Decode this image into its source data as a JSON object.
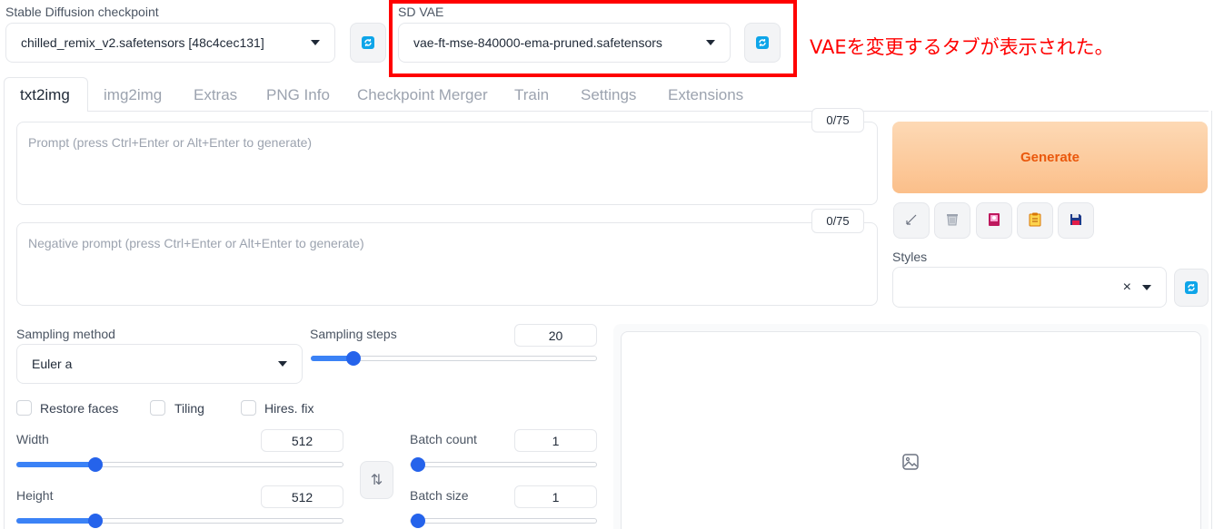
{
  "checkpoint": {
    "label": "Stable Diffusion checkpoint",
    "value": "chilled_remix_v2.safetensors [48c4cec131]"
  },
  "vae": {
    "label": "SD VAE",
    "value": "vae-ft-mse-840000-ema-pruned.safetensors"
  },
  "annotation": "VAEを変更するタブが表示された。",
  "tabs": [
    "txt2img",
    "img2img",
    "Extras",
    "PNG Info",
    "Checkpoint Merger",
    "Train",
    "Settings",
    "Extensions"
  ],
  "prompt": {
    "placeholder": "Prompt (press Ctrl+Enter or Alt+Enter to generate)",
    "counter": "0/75"
  },
  "negative_prompt": {
    "placeholder": "Negative prompt (press Ctrl+Enter or Alt+Enter to generate)",
    "counter": "0/75"
  },
  "generate_label": "Generate",
  "styles": {
    "label": "Styles",
    "clear": "×"
  },
  "sampling": {
    "method_label": "Sampling method",
    "method_value": "Euler a",
    "steps_label": "Sampling steps",
    "steps_value": "20"
  },
  "checkboxes": {
    "restore_faces": "Restore faces",
    "tiling": "Tiling",
    "hires_fix": "Hires. fix"
  },
  "dims": {
    "width_label": "Width",
    "width_value": "512",
    "height_label": "Height",
    "height_value": "512",
    "swap_icon": "⇅"
  },
  "batch": {
    "count_label": "Batch count",
    "count_value": "1",
    "size_label": "Batch size",
    "size_value": "1"
  },
  "colors": {
    "accent": "#2563eb",
    "generate_text": "#ea580c",
    "annotation": "#ff0000"
  }
}
